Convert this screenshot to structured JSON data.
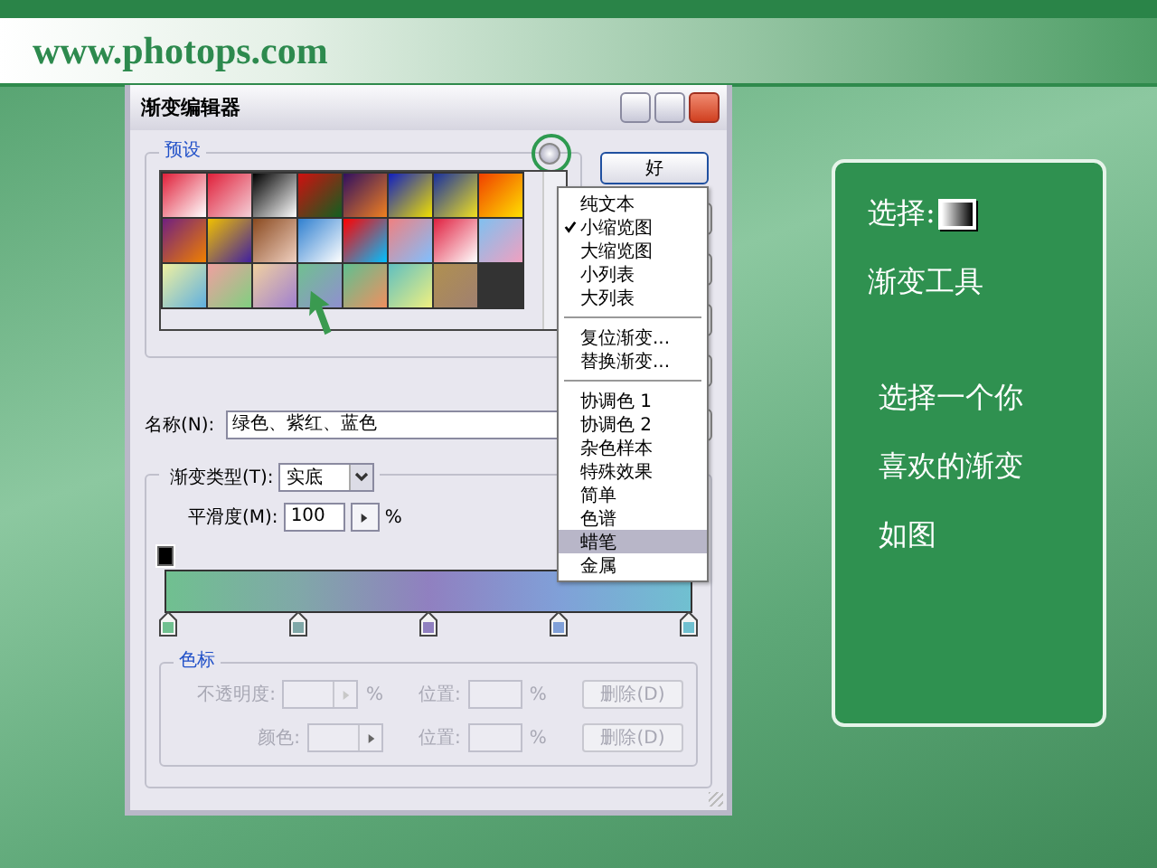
{
  "site_header": {
    "text": "www.photops.com"
  },
  "dialog": {
    "title": "渐变编辑器",
    "presets": {
      "label": "预设"
    },
    "ok_button": "好",
    "name_label": "名称(N):",
    "name_value": "绿色、紫红、蓝色",
    "type_label": "渐变类型(T):",
    "type_value": "实底",
    "smooth_label": "平滑度(M):",
    "smooth_value": "100",
    "smooth_unit": "%",
    "stops_group": {
      "label": "色标",
      "rows": [
        {
          "label": "不透明度:",
          "unit": "%",
          "position_label": "位置:",
          "position_unit": "%",
          "delete_button": "删除(D)"
        },
        {
          "label": "颜色:",
          "position_label": "位置:",
          "position_unit": "%",
          "delete_button": "删除(D)"
        }
      ]
    }
  },
  "menu": [
    {
      "kind": "item",
      "label": "纯文本",
      "checked": false,
      "selected": false
    },
    {
      "kind": "item",
      "label": "小缩览图",
      "checked": true,
      "selected": false
    },
    {
      "kind": "item",
      "label": "大缩览图",
      "checked": false,
      "selected": false
    },
    {
      "kind": "item",
      "label": "小列表",
      "checked": false,
      "selected": false
    },
    {
      "kind": "item",
      "label": "大列表",
      "checked": false,
      "selected": false
    },
    {
      "kind": "separator"
    },
    {
      "kind": "item",
      "label": "复位渐变...",
      "checked": false,
      "selected": false
    },
    {
      "kind": "item",
      "label": "替换渐变...",
      "checked": false,
      "selected": false
    },
    {
      "kind": "separator"
    },
    {
      "kind": "item",
      "label": "协调色 1",
      "checked": false,
      "selected": false
    },
    {
      "kind": "item",
      "label": "协调色 2",
      "checked": false,
      "selected": false
    },
    {
      "kind": "item",
      "label": "杂色样本",
      "checked": false,
      "selected": false
    },
    {
      "kind": "item",
      "label": "特殊效果",
      "checked": false,
      "selected": false
    },
    {
      "kind": "item",
      "label": "简单",
      "checked": false,
      "selected": false
    },
    {
      "kind": "item",
      "label": "色谱",
      "checked": false,
      "selected": false
    },
    {
      "kind": "item",
      "label": "蜡笔",
      "checked": false,
      "selected": true
    },
    {
      "kind": "item",
      "label": "金属",
      "checked": false,
      "selected": false
    }
  ],
  "note_panel": {
    "select_label": "选择:",
    "tool_name": "渐变工具",
    "lines": [
      "选择一个你",
      "喜欢的渐变",
      "如图"
    ]
  }
}
